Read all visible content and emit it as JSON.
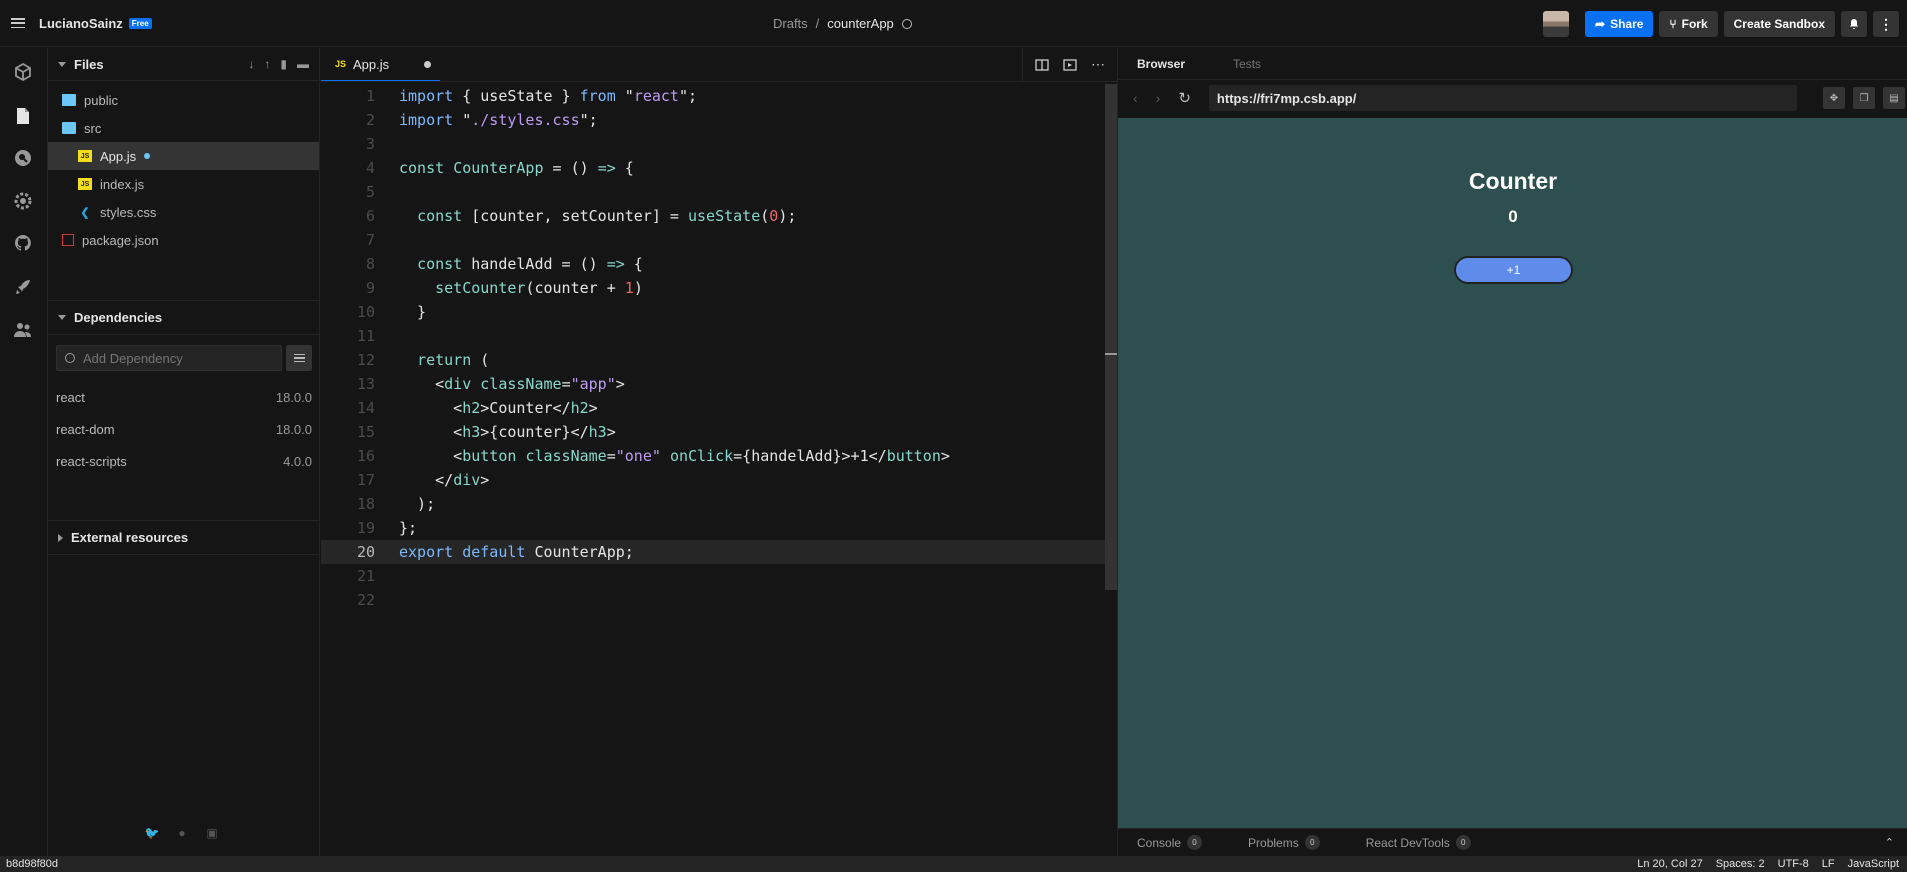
{
  "topbar": {
    "user_name": "LucianoSainz",
    "plan_badge": "Free",
    "breadcrumb_folder": "Drafts",
    "breadcrumb_sep": "/",
    "project_name": "counterApp",
    "share_label": "Share",
    "fork_label": "Fork",
    "create_label": "Create Sandbox"
  },
  "sidebar": {
    "files_title": "Files",
    "tree": [
      {
        "name": "public",
        "type": "folder"
      },
      {
        "name": "src",
        "type": "folder"
      },
      {
        "name": "App.js",
        "type": "js"
      },
      {
        "name": "index.js",
        "type": "js"
      },
      {
        "name": "styles.css",
        "type": "css"
      },
      {
        "name": "package.json",
        "type": "json"
      }
    ],
    "dependencies_title": "Dependencies",
    "add_dependency_placeholder": "Add Dependency",
    "dependencies": [
      {
        "name": "react",
        "version": "18.0.0"
      },
      {
        "name": "react-dom",
        "version": "18.0.0"
      },
      {
        "name": "react-scripts",
        "version": "4.0.0"
      }
    ],
    "external_title": "External resources"
  },
  "editor": {
    "tab_label": "App.js",
    "tab_badge": "JS",
    "line_numbers": [
      "1",
      "2",
      "3",
      "4",
      "5",
      "6",
      "7",
      "8",
      "9",
      "10",
      "11",
      "12",
      "13",
      "14",
      "15",
      "16",
      "17",
      "18",
      "19",
      "20",
      "21",
      "22"
    ],
    "current_line": 20
  },
  "preview": {
    "tab_browser": "Browser",
    "tab_tests": "Tests",
    "url": "https://fri7mp.csb.app/",
    "heading": "Counter",
    "counter_value": "0",
    "button_label": "+1",
    "bottom": {
      "console_label": "Console",
      "console_count": "0",
      "problems_label": "Problems",
      "problems_count": "0",
      "devtools_label": "React DevTools",
      "devtools_count": "0"
    }
  },
  "statusbar": {
    "commit": "b8d98f80d",
    "position": "Ln 20, Col 27",
    "spaces": "Spaces: 2",
    "encoding": "UTF-8",
    "eol": "LF",
    "language": "JavaScript"
  },
  "colors": {
    "accent": "#0971f1",
    "preview_bg": "#2e4f4f",
    "preview_button": "#5f8bea"
  }
}
